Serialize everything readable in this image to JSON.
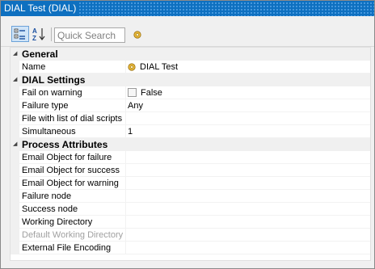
{
  "window": {
    "title": "DIAL Test (DIAL)"
  },
  "toolbar": {
    "categorized_icon": "categorized-view-icon",
    "alphabetical_icon": "alphabetical-sort-icon",
    "search_placeholder": "Quick Search",
    "extra_icon": "property-pages-icon"
  },
  "colors": {
    "title_bar": "#0e70c0",
    "selected_button": "#cfe4f8",
    "disabled_text": "#a0a0a0"
  },
  "grid": {
    "categories": [
      {
        "label": "General",
        "properties": [
          {
            "name": "Name",
            "value": "DIAL Test",
            "value_icon": "object-icon"
          }
        ]
      },
      {
        "label": "DIAL Settings",
        "properties": [
          {
            "name": "Fail on warning",
            "value": "False",
            "type": "checkbox",
            "checked": false
          },
          {
            "name": "Failure type",
            "value": "Any"
          },
          {
            "name": "File with list of dial scripts",
            "value": ""
          },
          {
            "name": "Simultaneous",
            "value": "1"
          }
        ]
      },
      {
        "label": "Process Attributes",
        "properties": [
          {
            "name": "Email Object for failure",
            "value": ""
          },
          {
            "name": "Email Object for success",
            "value": ""
          },
          {
            "name": "Email Object for warning",
            "value": ""
          },
          {
            "name": "Failure node",
            "value": ""
          },
          {
            "name": "Success node",
            "value": ""
          },
          {
            "name": "Working Directory",
            "value": ""
          },
          {
            "name": "Default Working Directory",
            "value": "",
            "disabled": true
          },
          {
            "name": "External File Encoding",
            "value": ""
          }
        ]
      }
    ]
  }
}
